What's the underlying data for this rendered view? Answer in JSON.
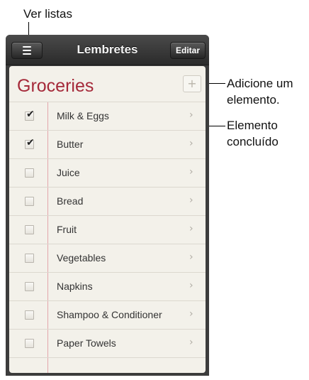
{
  "callouts": {
    "view_lists": "Ver listas",
    "add_item_line1": "Adicione um",
    "add_item_line2": "elemento.",
    "done_item_line1": "Elemento",
    "done_item_line2": "concluído"
  },
  "navbar": {
    "title": "Lembretes",
    "menu_icon": "hamburger-icon",
    "edit_label": "Editar"
  },
  "list": {
    "title": "Groceries",
    "add_symbol": "+",
    "items": [
      {
        "label": "Milk & Eggs",
        "done": true
      },
      {
        "label": "Butter",
        "done": true
      },
      {
        "label": "Juice",
        "done": false
      },
      {
        "label": "Bread",
        "done": false
      },
      {
        "label": "Fruit",
        "done": false
      },
      {
        "label": "Vegetables",
        "done": false
      },
      {
        "label": "Napkins",
        "done": false
      },
      {
        "label": "Shampoo & Conditioner",
        "done": false
      },
      {
        "label": "Paper Towels",
        "done": false
      }
    ]
  },
  "colors": {
    "list_title": "#a52a3a",
    "margin_line": "#e3a6ac",
    "paper": "#f3f1ea"
  }
}
